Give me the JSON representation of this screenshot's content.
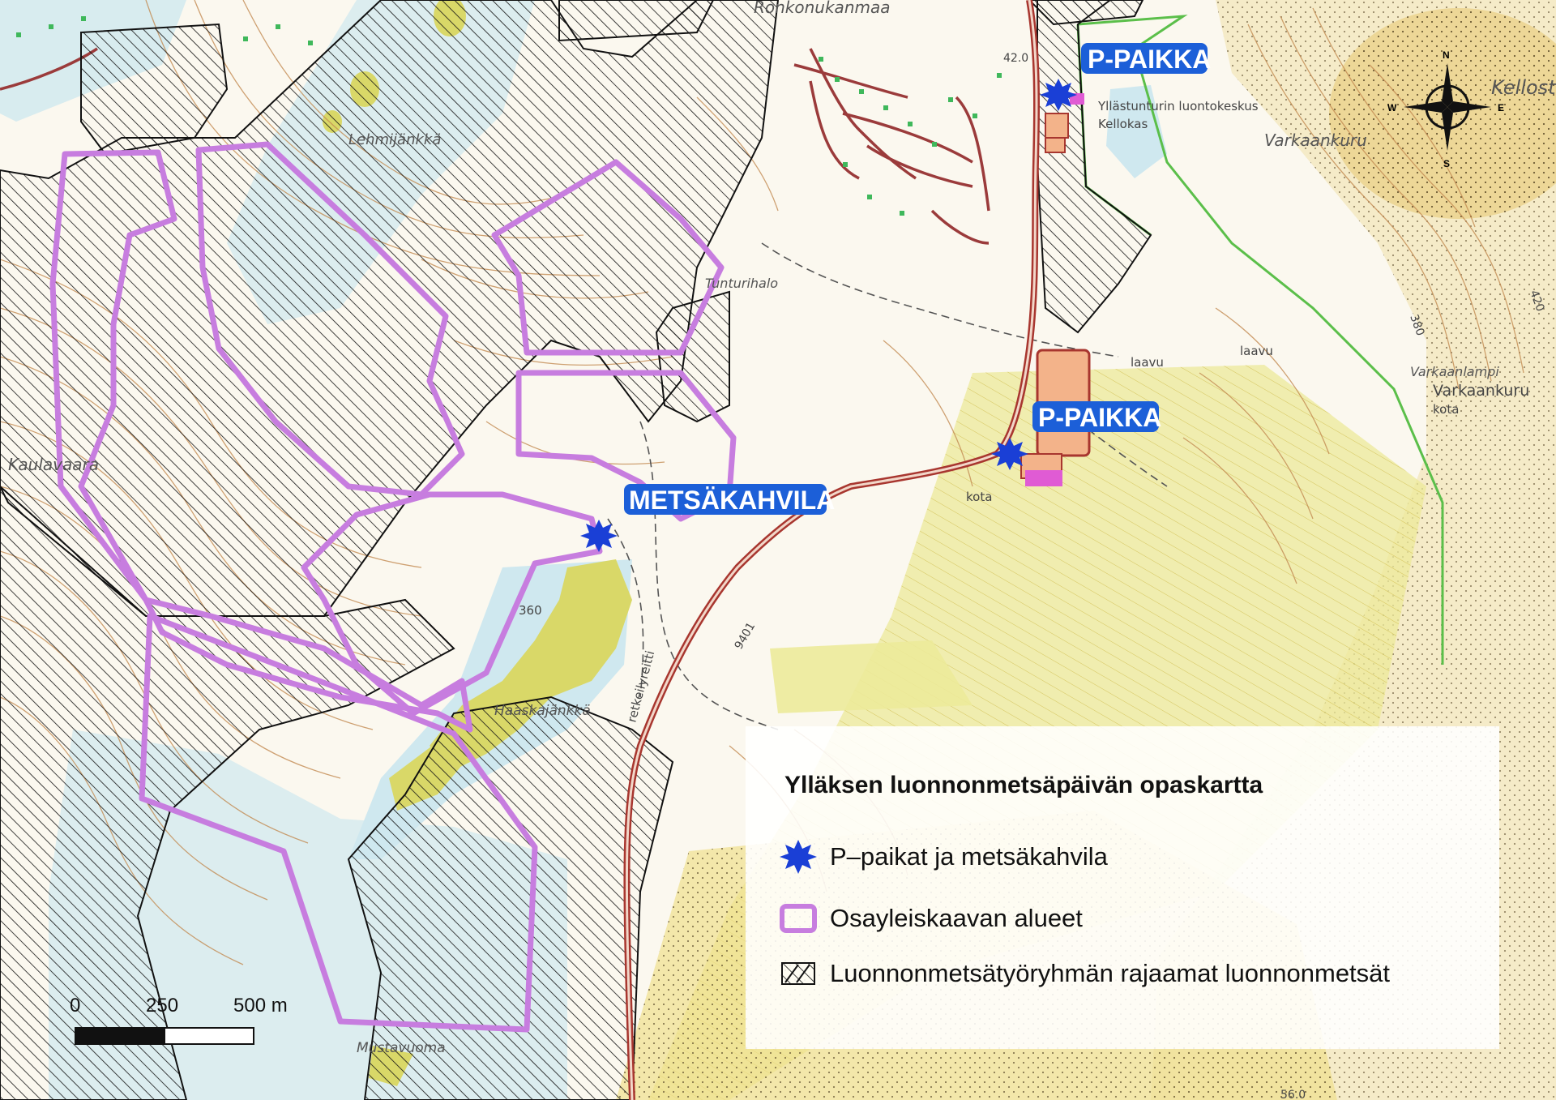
{
  "place_names": {
    "ronkonukanmaa": "Ronkonukanmaa",
    "lehmijankka": "Lehmijänkkä",
    "tunturihalo": "Tunturihalo",
    "kaulavaara": "Kaulavaara",
    "haaskajankka": "Haaskajänkkä",
    "mustavuoma": "Mustavuoma",
    "varkaankuru_top": "Varkaankuru",
    "varkaankuru_right": "Varkaankuru",
    "varkaanlampi": "Varkaanlampi",
    "kellostapuli": "Kellost",
    "luontokeskus": "Yllästunturin luontokeskus",
    "kellokas": "Kellokas",
    "laavu_1": "laavu",
    "laavu_2": "laavu",
    "kota_1": "kota",
    "kota_2": "kota",
    "retkeilyreitti": "retkeilyreitti",
    "road_number": "9401",
    "contour_360": "360",
    "contour_380": "380",
    "elev_420": "420",
    "elev_560": "56.0",
    "elev_top": "42.0"
  },
  "map_labels": {
    "p_paikka_1": "P-PAIKKA",
    "p_paikka_2": "P-PAIKKA",
    "metsakahvila": "METSÄKAHVILA"
  },
  "compass": {
    "n": "N",
    "s": "S",
    "w": "W",
    "e": "E"
  },
  "scale_bar": {
    "tick_0": "0",
    "tick_1": "250",
    "tick_2": "500 m"
  },
  "legend": {
    "title": "Ylläksen luonnonmetsäpäivän opaskartta",
    "items": [
      {
        "label": "P–paikat ja metsäkahvila",
        "symbol": "blue-star-icon"
      },
      {
        "label": "Osayleiskaavan alueet",
        "symbol": "purple-outline-box"
      },
      {
        "label": "Luonnonmetsätyöryhmän rajaamat luonnonmetsät",
        "symbol": "hatched-box"
      }
    ]
  },
  "colors": {
    "plan_outline": "#c77ddf",
    "star": "#1a3fd6",
    "label_bg": "#1c5fd8",
    "road": "#a8362f",
    "wetland": "#cfe8ef",
    "field_yellow": "#e6e48a",
    "parking_orange": "#f3b38a",
    "green_border": "#5bbf4a"
  }
}
